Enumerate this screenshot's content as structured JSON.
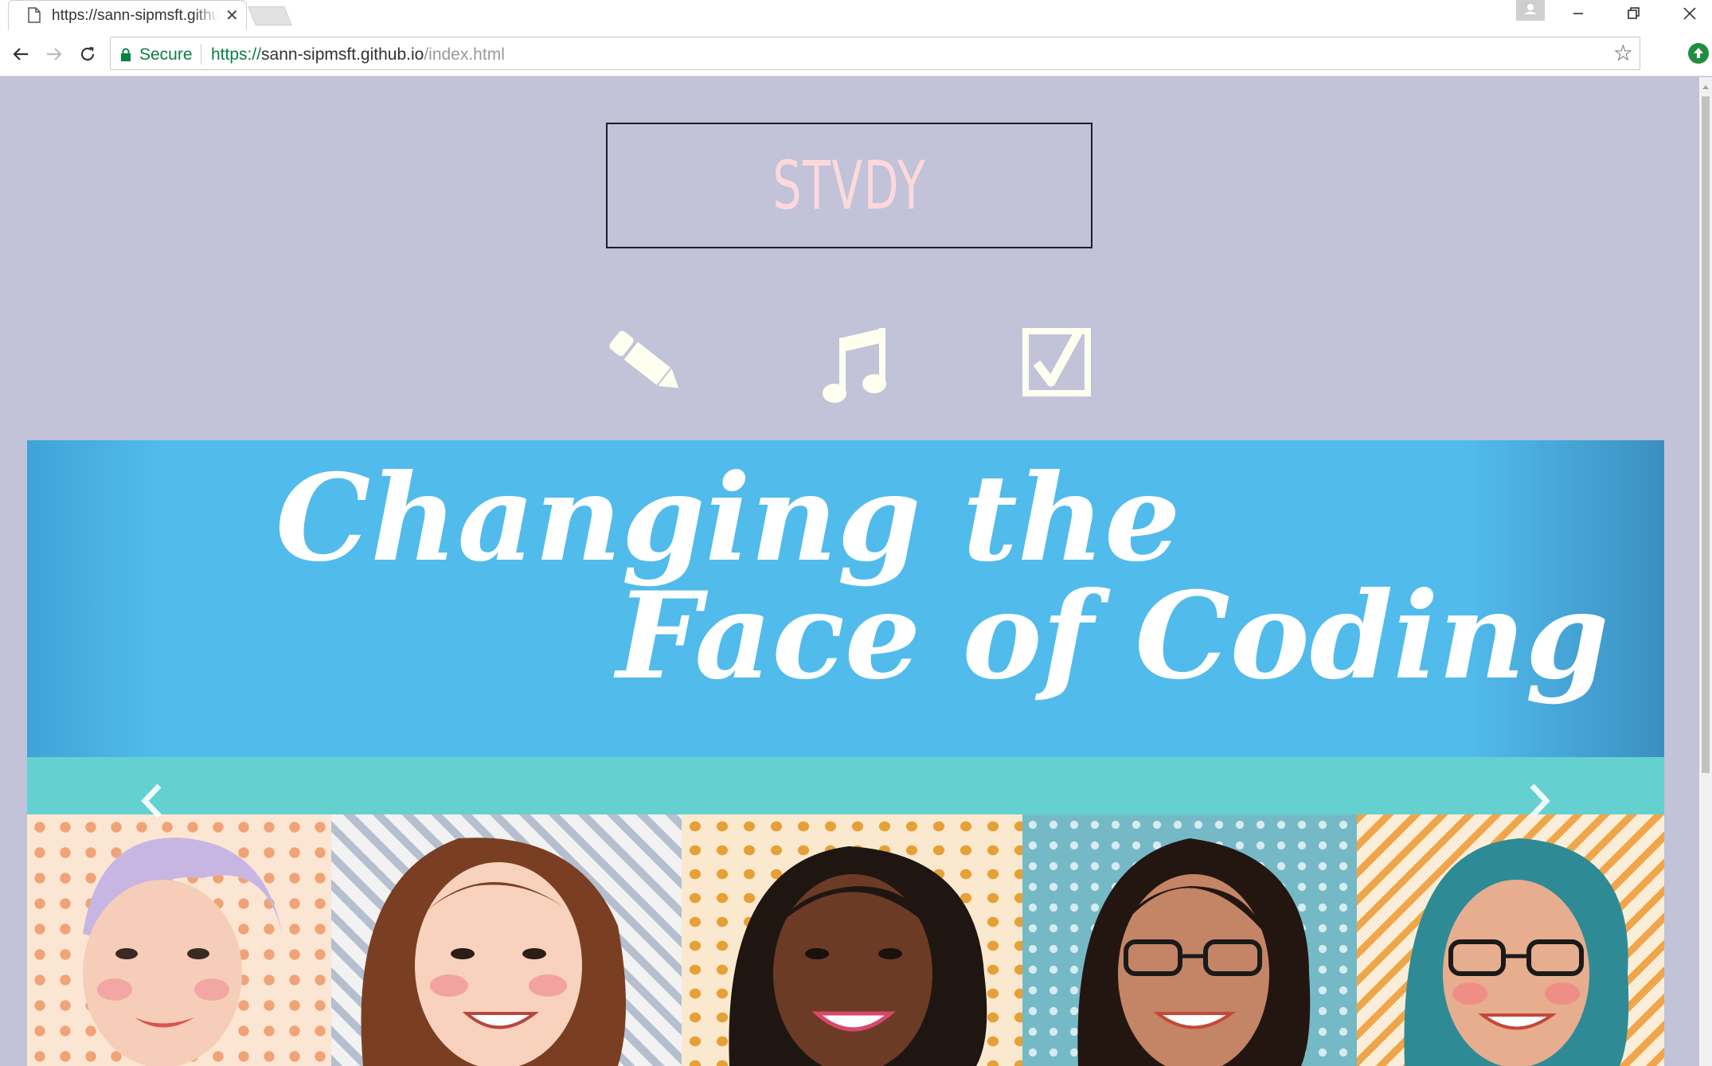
{
  "browser": {
    "tab_title": "https://sann-sipmsft.github.io/index.html",
    "secure_label": "Secure",
    "url_scheme": "https://",
    "url_host": "sann-sipmsft.github.io",
    "url_path": "/index.html"
  },
  "page": {
    "logo": "STVDY",
    "nav_icons": [
      "pencil-icon",
      "music-note-icon",
      "checkbox-icon"
    ],
    "banner": {
      "title_line1": "Changing the",
      "title_line2": "Face of Coding"
    }
  },
  "colors": {
    "page_bg": "#c2c2d8",
    "logo_text": "#fbd9db",
    "icons": "#fffff0",
    "banner_blue": "#51bbec",
    "banner_teal": "#65d0d0"
  }
}
